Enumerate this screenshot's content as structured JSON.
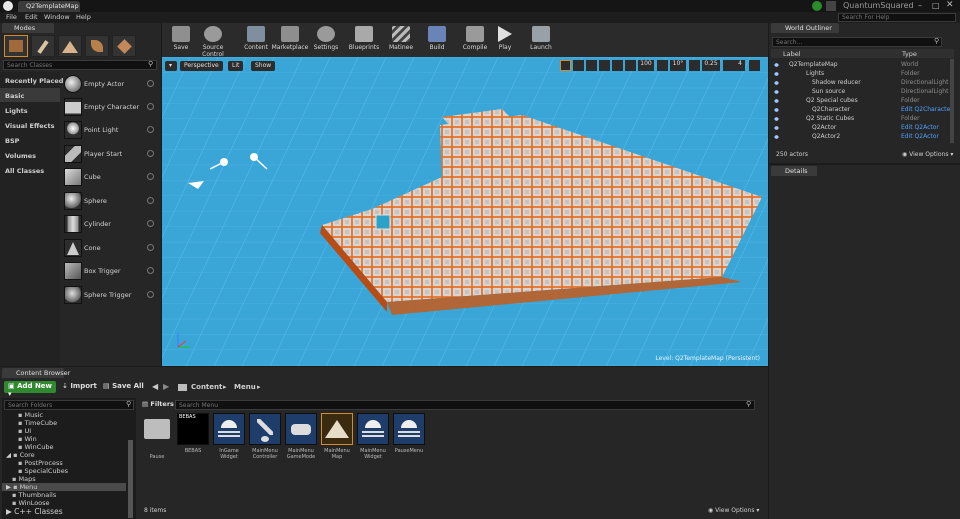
{
  "window": {
    "title": "Q2TemplateMap",
    "project": "QuantumSquared",
    "search_help_placeholder": "Search For Help"
  },
  "menu": [
    "File",
    "Edit",
    "Window",
    "Help"
  ],
  "modes": {
    "tab": "Modes",
    "search_placeholder": "Search Classes"
  },
  "categories": [
    "Recently Placed",
    "Basic",
    "Lights",
    "Visual Effects",
    "BSP",
    "Volumes",
    "All Classes"
  ],
  "place_items": [
    "Empty Actor",
    "Empty Character",
    "Point Light",
    "Player Start",
    "Cube",
    "Sphere",
    "Cylinder",
    "Cone",
    "Box Trigger",
    "Sphere Trigger"
  ],
  "toolbar": [
    "Save",
    "Source Control",
    "Content",
    "Marketplace",
    "Settings",
    "Blueprints",
    "Matinee",
    "Build",
    "Compile",
    "Play",
    "Launch"
  ],
  "viewport": {
    "perspective": "Perspective",
    "lit": "Lit",
    "show": "Show",
    "grid_snap": "100",
    "rot_snap": "10°",
    "scale_snap": "0.25",
    "cam_speed": "4",
    "level_label": "Level:  Q2TemplateMap (Persistent)"
  },
  "outliner": {
    "tab": "World Outliner",
    "search_placeholder": "Search...",
    "col_label": "Label",
    "col_type": "Type",
    "rows": [
      {
        "label": "Q2TemplateMap",
        "type": "World"
      },
      {
        "label": "Lights",
        "type": "Folder"
      },
      {
        "label": "Shadow reducer",
        "type": "DirectionalLight"
      },
      {
        "label": "Sun source",
        "type": "DirectionalLight"
      },
      {
        "label": "Q2 Special cubes",
        "type": "Folder"
      },
      {
        "label": "Q2Character",
        "type": "Edit Q2Characte"
      },
      {
        "label": "Q2 Static Cubes",
        "type": "Folder"
      },
      {
        "label": "Q2Actor",
        "type": "Edit Q2Actor"
      },
      {
        "label": "Q2Actor2",
        "type": "Edit Q2Actor"
      }
    ],
    "count": "250 actors",
    "view_options": "View Options"
  },
  "details": {
    "tab": "Details"
  },
  "content_browser": {
    "tab": "Content Browser",
    "add_new": "Add New",
    "import": "Import",
    "save_all": "Save All",
    "path": [
      "Content",
      "Menu"
    ],
    "folder_search_placeholder": "Search Folders",
    "filters": "Filters",
    "asset_search_placeholder": "Search Menu",
    "folders": [
      "Music",
      "TimeCube",
      "UI",
      "Win",
      "WinCube",
      "Core",
      "PostProcess",
      "SpecialCubes",
      "Maps",
      "Menu",
      "Thumbnails",
      "WinLoose",
      "C++ Classes"
    ],
    "assets": [
      {
        "name": "Pause",
        "line2": ""
      },
      {
        "name": "BEBAS",
        "line2": ""
      },
      {
        "name": "InGame",
        "line2": "Widget"
      },
      {
        "name": "MainMenu",
        "line2": "Controller"
      },
      {
        "name": "MainMenu",
        "line2": "GameMode"
      },
      {
        "name": "MainMenu",
        "line2": "Map"
      },
      {
        "name": "MainMenu",
        "line2": "Widget"
      },
      {
        "name": "PauseMenu",
        "line2": ""
      }
    ],
    "bebas_thumb_text": "BEBAS",
    "item_count": "8 items",
    "view_options": "View Options"
  }
}
